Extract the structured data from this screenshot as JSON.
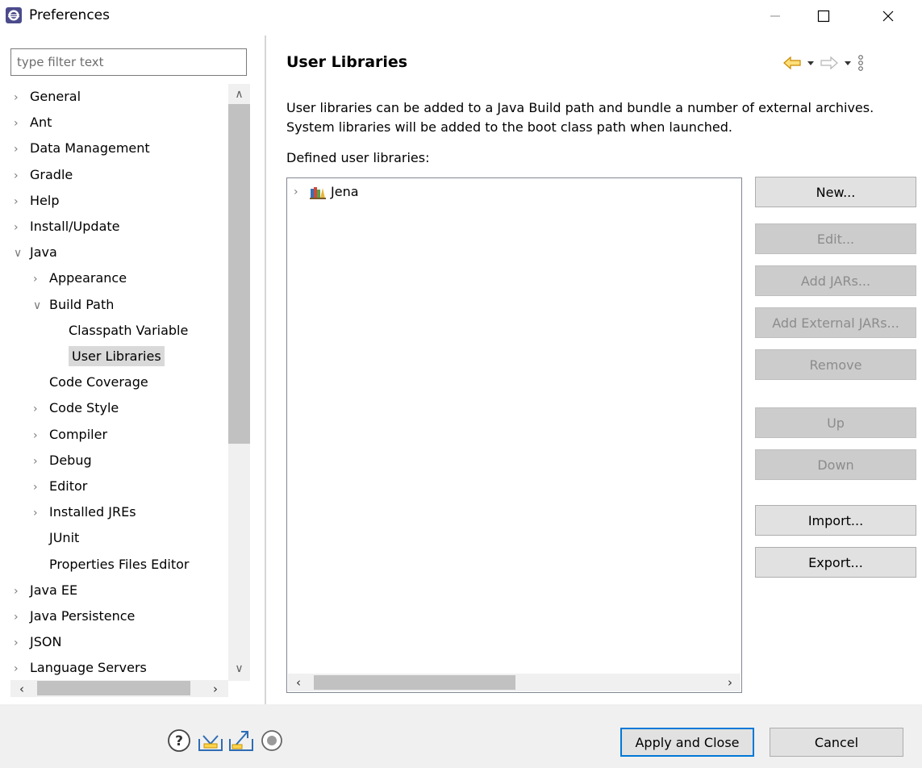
{
  "window": {
    "title": "Preferences",
    "app_icon": "eclipse-icon",
    "controls": [
      "minimize-icon",
      "maximize-icon",
      "close-icon"
    ]
  },
  "filter": {
    "placeholder": "type filter text",
    "value": ""
  },
  "tree": {
    "items": [
      {
        "label": "General",
        "state": "collapsed"
      },
      {
        "label": "Ant",
        "state": "collapsed"
      },
      {
        "label": "Data Management",
        "state": "collapsed"
      },
      {
        "label": "Gradle",
        "state": "collapsed"
      },
      {
        "label": "Help",
        "state": "collapsed"
      },
      {
        "label": "Install/Update",
        "state": "collapsed"
      },
      {
        "label": "Java",
        "state": "expanded"
      },
      {
        "label": "Appearance",
        "state": "collapsed"
      },
      {
        "label": "Build Path",
        "state": "expanded"
      },
      {
        "label": "Classpath Variable",
        "state": "leaf"
      },
      {
        "label": "User Libraries",
        "state": "leaf",
        "selected": true
      },
      {
        "label": "Code Coverage",
        "state": "leaf"
      },
      {
        "label": "Code Style",
        "state": "collapsed"
      },
      {
        "label": "Compiler",
        "state": "collapsed"
      },
      {
        "label": "Debug",
        "state": "collapsed"
      },
      {
        "label": "Editor",
        "state": "collapsed"
      },
      {
        "label": "Installed JREs",
        "state": "collapsed"
      },
      {
        "label": "JUnit",
        "state": "leaf"
      },
      {
        "label": "Properties Files Editor",
        "state": "leaf"
      },
      {
        "label": "Java EE",
        "state": "collapsed"
      },
      {
        "label": "Java Persistence",
        "state": "collapsed"
      },
      {
        "label": "JSON",
        "state": "collapsed"
      },
      {
        "label": "Language Servers",
        "state": "collapsed"
      }
    ]
  },
  "page": {
    "title": "User Libraries",
    "description": "User libraries can be added to a Java Build path and bundle a number of external archives. System libraries will be added to the boot class path when launched.",
    "defined_label": "Defined user libraries:",
    "nav_icons": [
      "back-arrow-icon",
      "dropdown-icon",
      "forward-arrow-icon",
      "dropdown-icon",
      "view-menu-icon"
    ],
    "libraries": [
      {
        "name": "Jena",
        "icon": "library-icon"
      }
    ]
  },
  "buttons": [
    {
      "label": "New...",
      "enabled": true
    },
    {
      "label": "Edit...",
      "enabled": false
    },
    {
      "label": "Add JARs...",
      "enabled": false
    },
    {
      "label": "Add External JARs...",
      "enabled": false
    },
    {
      "label": "Remove",
      "enabled": false
    },
    {
      "label": "Up",
      "enabled": false
    },
    {
      "label": "Down",
      "enabled": false
    },
    {
      "label": "Import...",
      "enabled": true
    },
    {
      "label": "Export...",
      "enabled": true
    }
  ],
  "footer": {
    "icons": [
      "help-icon",
      "import-icon",
      "export-icon",
      "record-icon"
    ],
    "apply_close": "Apply and Close",
    "cancel": "Cancel"
  },
  "colors": {
    "accent": "#0078d7",
    "selection": "#d9d9d9",
    "disabled_button": "#cccccc",
    "nav_back": "#e8a000"
  }
}
